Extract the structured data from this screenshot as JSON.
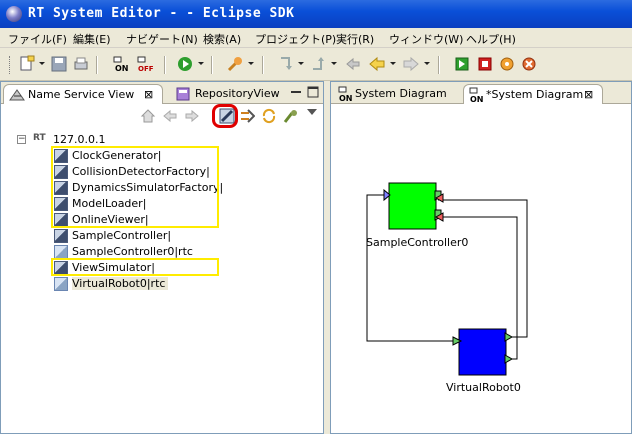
{
  "window": {
    "title": "RT System Editor -  - Eclipse SDK"
  },
  "menu": [
    {
      "label": "ファイル(F)"
    },
    {
      "label": "編集(E)"
    },
    {
      "label": "ナビゲート(N)"
    },
    {
      "label": "検索(A)"
    },
    {
      "label": "プロジェクト(P)"
    },
    {
      "label": "実行(R)"
    },
    {
      "label": "ウィンドウ(W)"
    },
    {
      "label": "ヘルプ(H)"
    }
  ],
  "toolbar_icons": [
    "new-icon",
    "save-icon",
    "print-icon",
    "rtc-on-icon",
    "rtc-off-icon",
    "run-icon",
    "debug-icon",
    "external-tools-icon",
    "back-icon",
    "forward-icon",
    "rtc-start-icon",
    "rtc-stop-icon",
    "rtc-config-icon",
    "rtc-exit-icon"
  ],
  "left_view": {
    "tabs": [
      {
        "label": "Name Service View",
        "active": true
      },
      {
        "label": "RepositoryView",
        "active": false
      }
    ],
    "tree": {
      "root": "127.0.0.1",
      "root_prefix": "RT",
      "items": [
        {
          "label": "ClockGenerator|",
          "kind": "manager"
        },
        {
          "label": "CollisionDetectorFactory|",
          "kind": "manager"
        },
        {
          "label": "DynamicsSimulatorFactory|",
          "kind": "manager"
        },
        {
          "label": "ModelLoader|",
          "kind": "manager"
        },
        {
          "label": "OnlineViewer|",
          "kind": "manager"
        },
        {
          "label": "SampleController|",
          "kind": "manager"
        },
        {
          "label": "SampleController0|rtc",
          "kind": "rtc"
        },
        {
          "label": "ViewSimulator|",
          "kind": "manager"
        },
        {
          "label": "VirtualRobot0|rtc",
          "kind": "rtc"
        }
      ]
    },
    "highlight_color": "#ffec00",
    "circle_color": "#e00000"
  },
  "editor": {
    "tabs": [
      {
        "label": "System Diagram",
        "active": false
      },
      {
        "label": "*System Diagram",
        "active": true
      }
    ],
    "components": [
      {
        "name": "SampleController0",
        "color": "#00ff00"
      },
      {
        "name": "VirtualRobot0",
        "color": "#0000ff"
      }
    ]
  }
}
